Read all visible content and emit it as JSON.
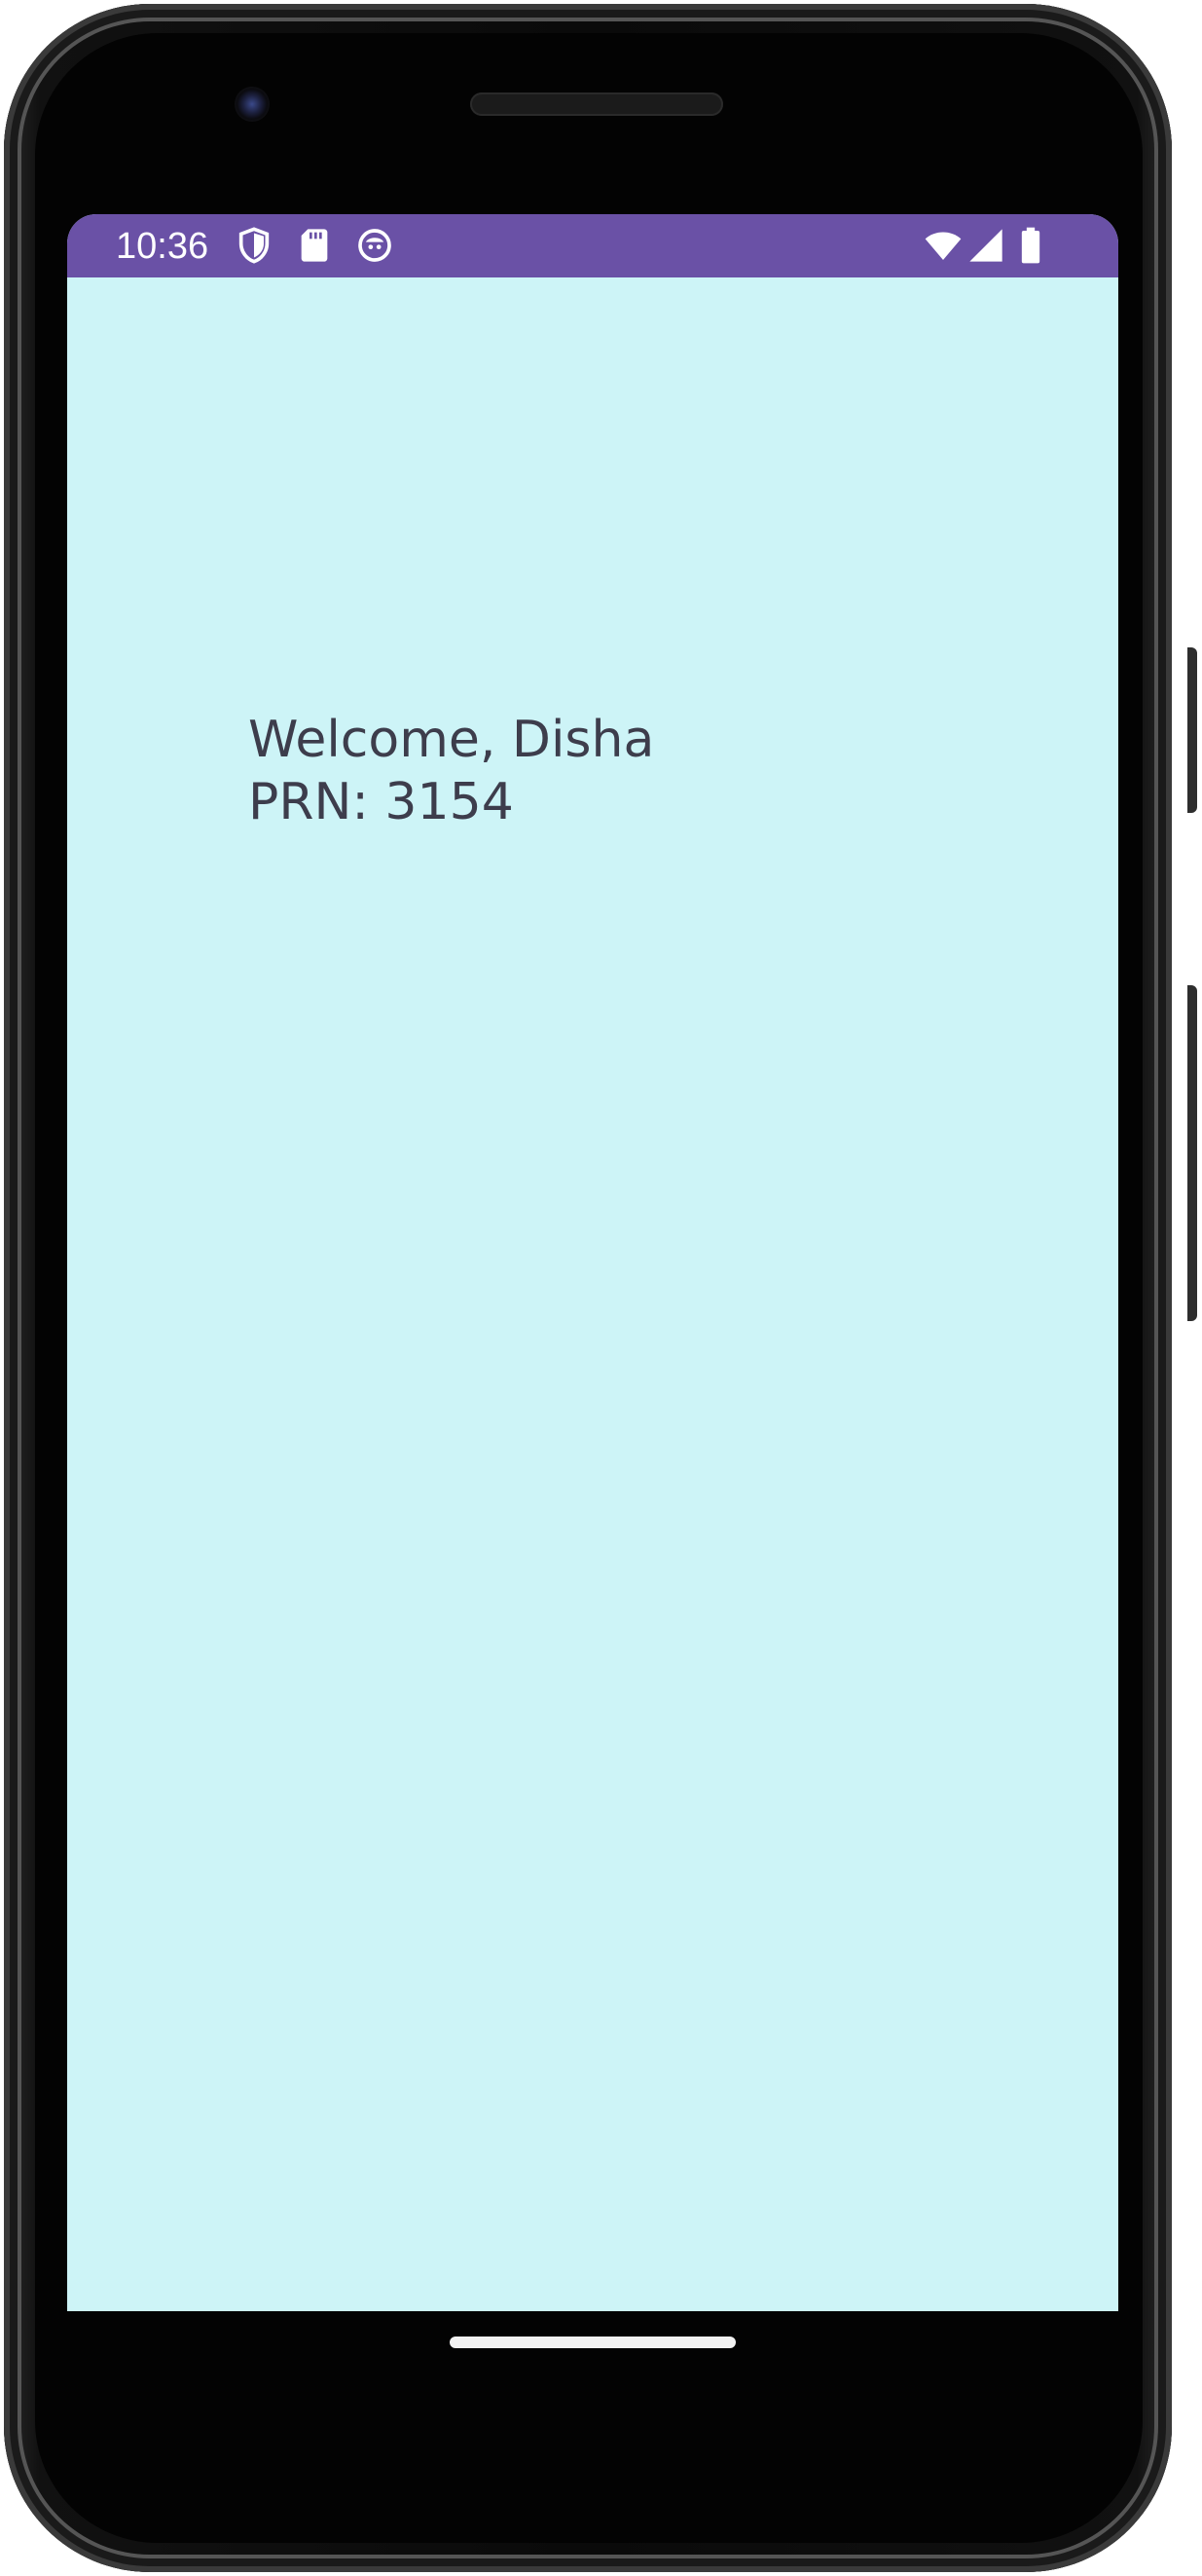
{
  "status_bar": {
    "time": "10:36",
    "color": "#6a51a6",
    "left_icons": [
      "shield-icon",
      "sd-card-icon",
      "face-icon"
    ],
    "right_icons": [
      "wifi-icon",
      "signal-icon",
      "battery-icon"
    ]
  },
  "screen": {
    "background": "#cdf4f7",
    "welcome_text": "Welcome, Disha",
    "prn_text": "PRN: 3154"
  }
}
